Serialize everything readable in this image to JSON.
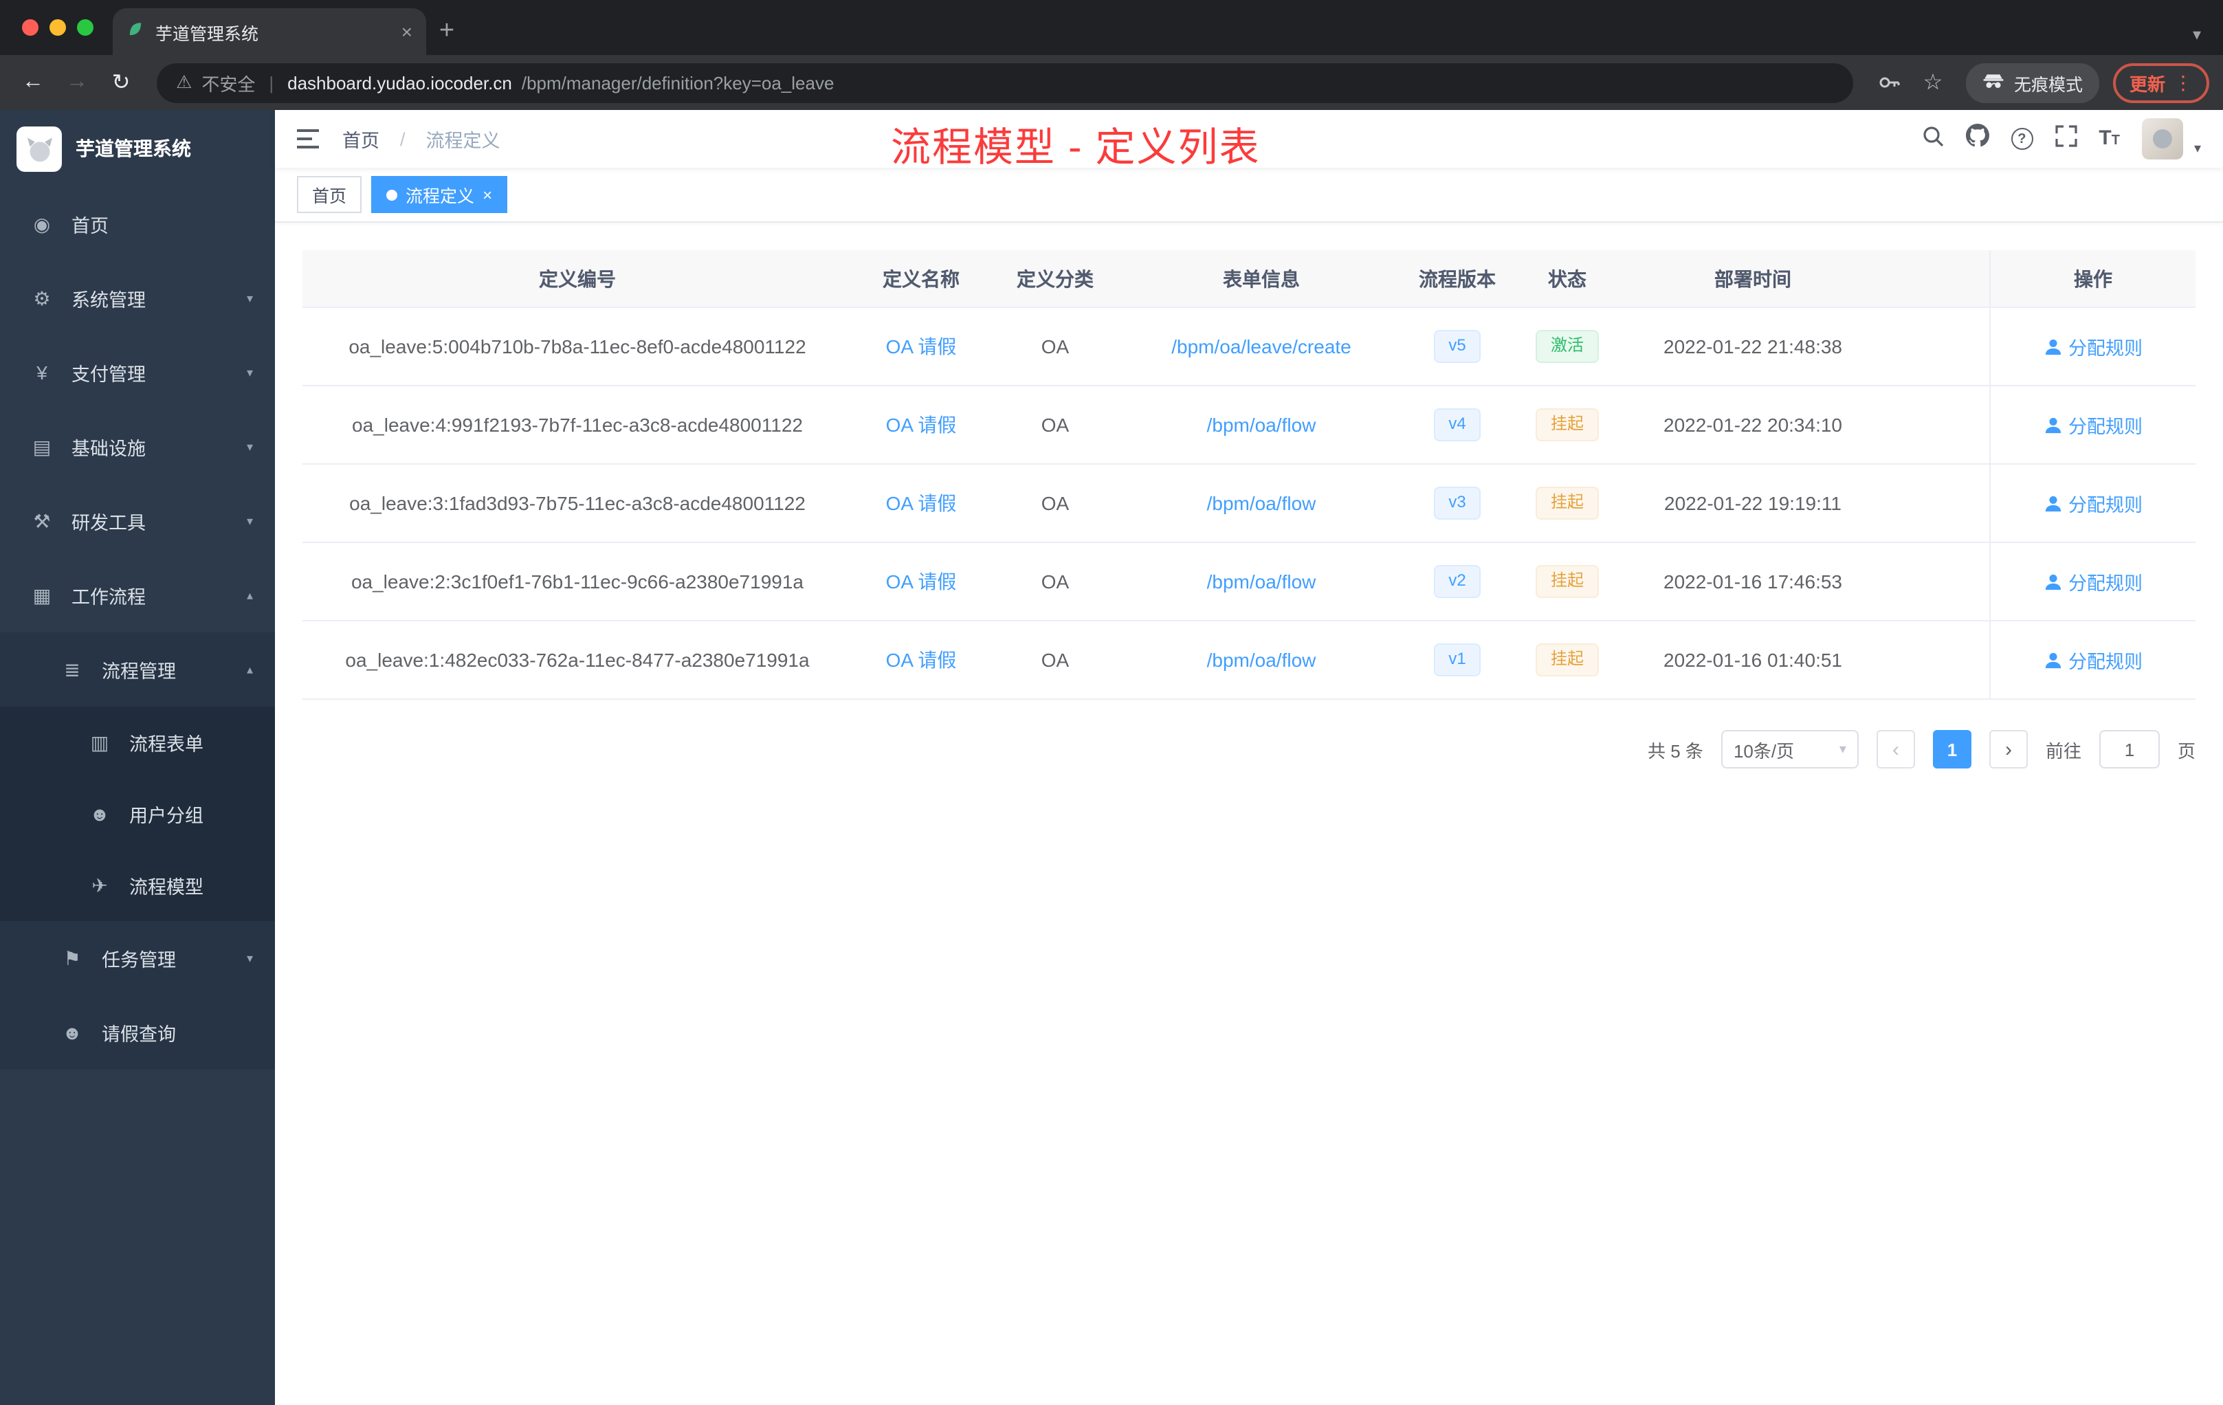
{
  "browser": {
    "tab_title": "芋道管理系统",
    "close_tab": "×",
    "new_tab": "+",
    "tabstrip_chevron": "▾",
    "back": "←",
    "forward": "→",
    "reload": "↻",
    "warning_glyph": "⚠",
    "security_label": "不安全",
    "url_domain": "dashboard.yudao.iocoder.cn",
    "url_path": "/bpm/manager/definition?key=oa_leave",
    "star": "☆",
    "incognito_label": "无痕模式",
    "update_label": "更新",
    "menu_dots": "⋮"
  },
  "glyphs": {
    "question": "?",
    "font_big": "T",
    "font_small": "T",
    "avatar_caret": "▾",
    "select_caret": "▾",
    "divider": "|"
  },
  "sidebar": {
    "logo_title": "芋道管理系统",
    "items": [
      {
        "glyph": "◉",
        "label": "首页",
        "chevron": ""
      },
      {
        "glyph": "⚙",
        "label": "系统管理",
        "chevron": "▾"
      },
      {
        "glyph": "¥",
        "label": "支付管理",
        "chevron": "▾"
      },
      {
        "glyph": "▤",
        "label": "基础设施",
        "chevron": "▾"
      },
      {
        "glyph": "⚒",
        "label": "研发工具",
        "chevron": "▾"
      },
      {
        "glyph": "▦",
        "label": "工作流程",
        "chevron": "▴"
      },
      {
        "glyph": "≣",
        "label": "流程管理",
        "chevron": "▴"
      },
      {
        "glyph": "▥",
        "label": "流程表单",
        "chevron": ""
      },
      {
        "glyph": "☻",
        "label": "用户分组",
        "chevron": ""
      },
      {
        "glyph": "✈",
        "label": "流程模型",
        "chevron": ""
      },
      {
        "glyph": "⚑",
        "label": "任务管理",
        "chevron": "▾"
      },
      {
        "glyph": "☻",
        "label": "请假查询",
        "chevron": ""
      }
    ]
  },
  "header": {
    "breadcrumb_home": "首页",
    "breadcrumb_sep": "/",
    "breadcrumb_current": "流程定义",
    "annotation": "流程模型 - 定义列表"
  },
  "tags": {
    "home": "首页",
    "current": "流程定义",
    "close": "×"
  },
  "table": {
    "columns": [
      "定义编号",
      "定义名称",
      "定义分类",
      "表单信息",
      "流程版本",
      "状态",
      "部署时间",
      "操作"
    ],
    "rows": [
      {
        "id": "oa_leave:5:004b710b-7b8a-11ec-8ef0-acde48001122",
        "name": "OA 请假",
        "category": "OA",
        "form": "/bpm/oa/leave/create",
        "version": "v5",
        "status": "激活",
        "time": "2022-01-22 21:48:38",
        "action": "分配规则"
      },
      {
        "id": "oa_leave:4:991f2193-7b7f-11ec-a3c8-acde48001122",
        "name": "OA 请假",
        "category": "OA",
        "form": "/bpm/oa/flow",
        "version": "v4",
        "status": "挂起",
        "time": "2022-01-22 20:34:10",
        "action": "分配规则"
      },
      {
        "id": "oa_leave:3:1fad3d93-7b75-11ec-a3c8-acde48001122",
        "name": "OA 请假",
        "category": "OA",
        "form": "/bpm/oa/flow",
        "version": "v3",
        "status": "挂起",
        "time": "2022-01-22 19:19:11",
        "action": "分配规则"
      },
      {
        "id": "oa_leave:2:3c1f0ef1-76b1-11ec-9c66-a2380e71991a",
        "name": "OA 请假",
        "category": "OA",
        "form": "/bpm/oa/flow",
        "version": "v2",
        "status": "挂起",
        "time": "2022-01-16 17:46:53",
        "action": "分配规则"
      },
      {
        "id": "oa_leave:1:482ec033-762a-11ec-8477-a2380e71991a",
        "name": "OA 请假",
        "category": "OA",
        "form": "/bpm/oa/flow",
        "version": "v1",
        "status": "挂起",
        "time": "2022-01-16 01:40:51",
        "action": "分配规则"
      }
    ]
  },
  "pagination": {
    "total": "共 5 条",
    "page_size": "10条/页",
    "prev": "‹",
    "page": "1",
    "next": "›",
    "goto_label": "前往",
    "goto_value": "1",
    "unit": "页"
  },
  "colors": {
    "accent_blue": "#409eff",
    "success_green": "#2cbd6b",
    "warning_orange": "#e6a23c",
    "annotation_red": "#fb3b3b"
  }
}
